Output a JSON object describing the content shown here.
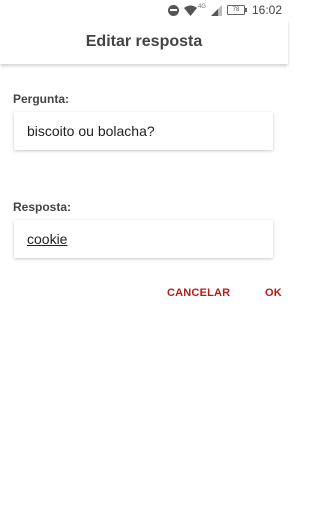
{
  "status_bar": {
    "time": "16:02",
    "battery": "78",
    "network_label": "4G"
  },
  "app_bar": {
    "title": "Editar resposta"
  },
  "form": {
    "question_label": "Pergunta:",
    "question_value": "biscoito ou bolacha?",
    "answer_label": "Resposta:",
    "answer_value": "cookie"
  },
  "actions": {
    "cancel_label": "CANCELAR",
    "ok_label": "OK"
  },
  "colors": {
    "accent": "#b71c1c"
  }
}
